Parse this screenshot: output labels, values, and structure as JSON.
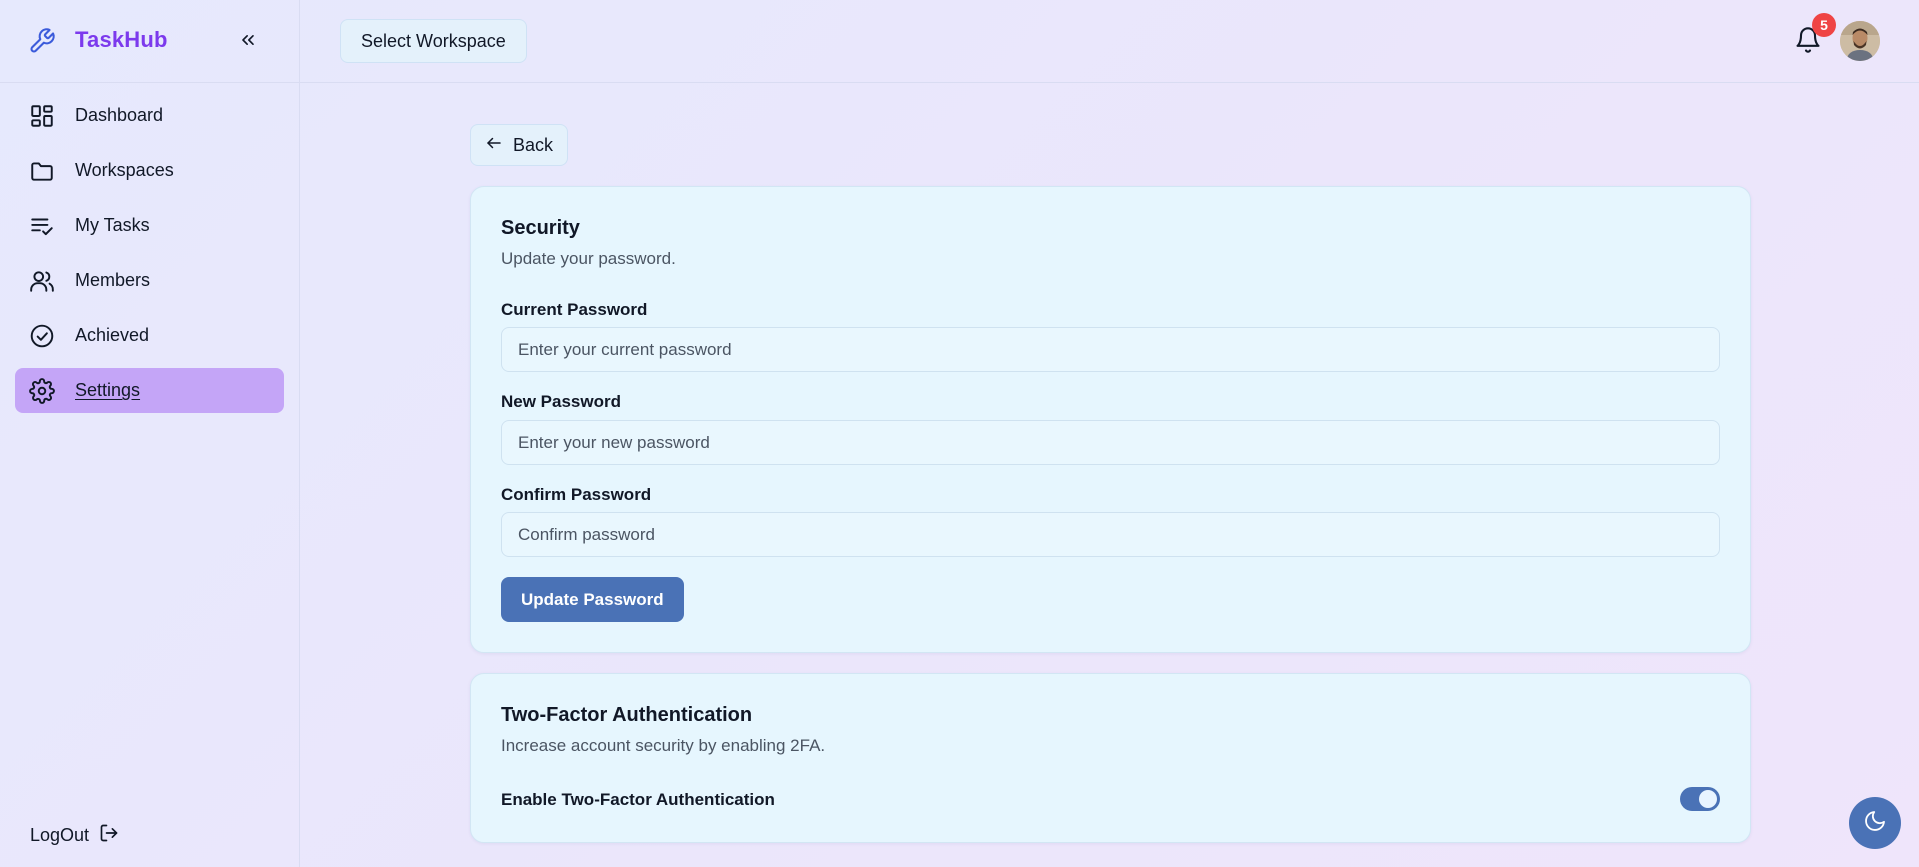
{
  "brand": {
    "name": "TaskHub",
    "logo_icon": "wrench-icon",
    "collapse_icon": "chevrons-left-icon"
  },
  "sidebar": {
    "items": [
      {
        "label": "Dashboard",
        "icon": "dashboard-grid-icon"
      },
      {
        "label": "Workspaces",
        "icon": "folder-icon"
      },
      {
        "label": "My Tasks",
        "icon": "list-check-icon"
      },
      {
        "label": "Members",
        "icon": "users-icon"
      },
      {
        "label": "Achieved",
        "icon": "check-circle-icon"
      },
      {
        "label": "Settings",
        "icon": "gear-icon",
        "active": true
      }
    ],
    "logout_label": "LogOut"
  },
  "header": {
    "workspace_button": "Select Workspace",
    "notification_count": "5"
  },
  "main": {
    "back_label": "Back",
    "security": {
      "title": "Security",
      "description": "Update your password.",
      "current_label": "Current Password",
      "current_placeholder": "Enter your current password",
      "new_label": "New Password",
      "new_placeholder": "Enter your new password",
      "confirm_label": "Confirm Password",
      "confirm_placeholder": "Confirm password",
      "submit_label": "Update Password"
    },
    "twofa": {
      "title": "Two-Factor Authentication",
      "description": "Increase account security by enabling 2FA.",
      "toggle_label": "Enable Two-Factor Authentication",
      "enabled": true
    }
  },
  "colors": {
    "brand": "#7c3aed",
    "active_nav": "#c4a5f7",
    "primary": "#4a72b6",
    "badge": "#ef4444",
    "card_bg": "#e6f6fe"
  }
}
